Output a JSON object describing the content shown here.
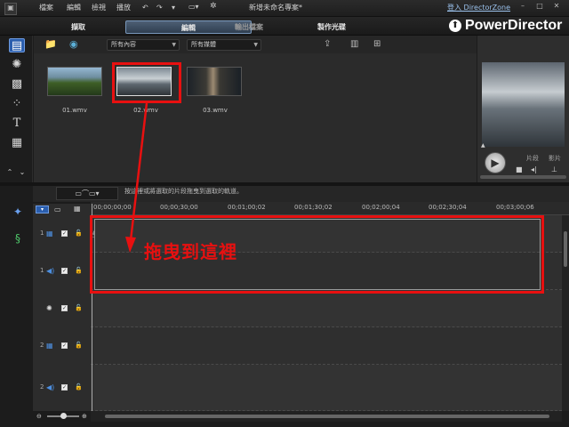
{
  "menubar": {
    "items": [
      "檔案",
      "編輯",
      "檢視",
      "播放"
    ],
    "title": "新增未命名專案*",
    "link": "登入 DirectorZone",
    "win_controls": [
      "–",
      "□",
      "✕"
    ]
  },
  "modebar": {
    "tabs": [
      "擷取",
      "編輯",
      "輸出檔案",
      "製作光碟"
    ],
    "active": "編輯",
    "logo": "PowerDirector"
  },
  "rail_icons": [
    "media-room-icon",
    "effects-icon",
    "pip-icon",
    "particle-icon",
    "title-icon",
    "transition-icon"
  ],
  "library": {
    "filter1": "所有內容",
    "filter2": "所有媒體",
    "clips": [
      {
        "label": "01.wmv"
      },
      {
        "label": "02.wmv"
      },
      {
        "label": "03.wmv"
      }
    ]
  },
  "preview": {
    "mode_clip": "片段",
    "mode_movie": "影片"
  },
  "timeline": {
    "hint": "按這裡或將選取的片段拖曳到選取的軌道。",
    "ruler": [
      "00;00;00;00",
      "00;00;30;00",
      "00;01;00;02",
      "00;01;30;02",
      "00;02;00;04",
      "00;02;30;04",
      "00;03;00;06"
    ],
    "tracks": [
      {
        "num": "1",
        "type": "video"
      },
      {
        "num": "1",
        "type": "audio"
      },
      {
        "num": "",
        "type": "effect"
      },
      {
        "num": "2",
        "type": "video"
      },
      {
        "num": "2",
        "type": "audio"
      }
    ]
  },
  "annotation": {
    "text": "拖曳到這裡"
  },
  "colors": {
    "accent": "#2a5eae",
    "annotation": "#e81010"
  }
}
